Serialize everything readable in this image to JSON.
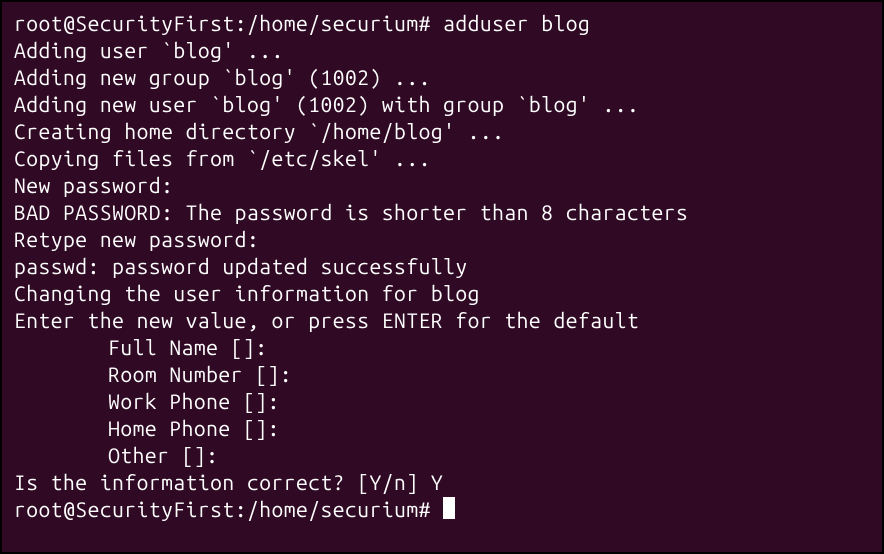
{
  "prompt1": {
    "user": "root",
    "host": "SecurityFirst",
    "path": "/home/securium",
    "symbol": "#",
    "command": "adduser blog"
  },
  "lines": {
    "l1": "Adding user `blog' ...",
    "l2": "Adding new group `blog' (1002) ...",
    "l3": "Adding new user `blog' (1002) with group `blog' ...",
    "l4": "Creating home directory `/home/blog' ...",
    "l5": "Copying files from `/etc/skel' ...",
    "l6": "New password:",
    "l7": "BAD PASSWORD: The password is shorter than 8 characters",
    "l8": "Retype new password:",
    "l9": "passwd: password updated successfully",
    "l10": "Changing the user information for blog",
    "l11": "Enter the new value, or press ENTER for the default",
    "l12": "Full Name []:",
    "l13": "Room Number []:",
    "l14": "Work Phone []:",
    "l15": "Home Phone []:",
    "l16": "Other []:",
    "l17": "Is the information correct? [Y/n] Y"
  },
  "prompt2": {
    "user": "root",
    "host": "SecurityFirst",
    "path": "/home/securium",
    "symbol": "#"
  }
}
